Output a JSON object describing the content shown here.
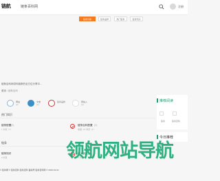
{
  "header": {
    "logo_text": "链航",
    "site_name": "链条百科网",
    "login_label": "注册"
  },
  "tabs": [
    "链条分类",
    "链条品牌",
    "热门链条",
    "链条知识"
  ],
  "intro_text": "链条百科网供你链条的全方位分享中...",
  "breadcrumb": {
    "home": "首页",
    "current": "链条百科"
  },
  "stats": [
    {
      "label": "网站",
      "value": "(0)"
    },
    {
      "label": "文章",
      "value": "(0)"
    },
    {
      "label": "链条品牌",
      "value": ""
    },
    {
      "label": "网站入",
      "value": "(0)"
    }
  ],
  "section_1": "热门知识",
  "items_row_1": [
    {
      "title": "链条配置",
      "count": "(0)",
      "meta": "1 浏览: (7)"
    },
    {
      "title": "链条百科配置",
      "count": "(0)",
      "meta": "收藏: (0)  浏览: (7)"
    }
  ],
  "section_2": "链条",
  "items_row_2": [
    {
      "title": "链条知识",
      "count": "",
      "meta": "0 浏览"
    },
    {
      "title": "SEO优化",
      "count": "",
      "meta": "0 浏览"
    }
  ],
  "footer_text": "© 链条网  © 链条百科 链条百科  备案号 链条百科网 © 2024-01-01",
  "sidebar": {
    "recommend_title": "推荐阅读",
    "recommend_items": [
      "链条",
      "链条百科"
    ],
    "ranking_title": "今日推荐"
  },
  "watermark_text": "领航网站导航",
  "colors": {
    "accent": "#f47a20",
    "sidebar_accent": "#1aa06e",
    "watermark": "#19a874"
  }
}
